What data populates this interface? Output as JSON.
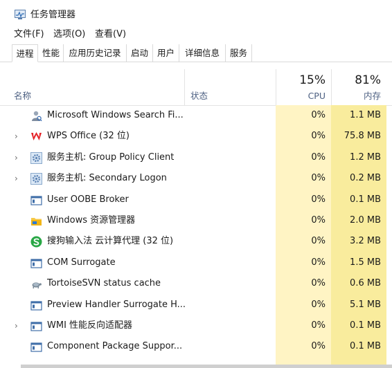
{
  "window": {
    "title": "任务管理器",
    "app_icon": "task-manager-icon"
  },
  "menu": [
    "文件(F)",
    "选项(O)",
    "查看(V)"
  ],
  "tabs": [
    "进程",
    "性能",
    "应用历史记录",
    "启动",
    "用户",
    "详细信息",
    "服务"
  ],
  "active_tab": "进程",
  "columns": {
    "name": "名称",
    "status": "状态",
    "cpu": {
      "label": "CPU",
      "percent": "15%"
    },
    "memory": {
      "label": "内存",
      "percent": "81%"
    }
  },
  "highlight_colors": {
    "cpu": "#fff4c4",
    "memory": "#f9ec9d"
  },
  "processes": [
    {
      "name": "Microsoft Windows Search Fi...",
      "cpu": "0%",
      "memory": "1.1 MB",
      "expandable": false,
      "icon": "search-filter-icon"
    },
    {
      "name": "WPS Office (32 位)",
      "cpu": "0%",
      "memory": "75.8 MB",
      "expandable": true,
      "icon": "wps-logo-icon"
    },
    {
      "name": "服务主机: Group Policy Client",
      "cpu": "0%",
      "memory": "1.2 MB",
      "expandable": true,
      "icon": "service-gear-icon"
    },
    {
      "name": "服务主机: Secondary Logon",
      "cpu": "0%",
      "memory": "0.2 MB",
      "expandable": true,
      "icon": "service-gear-icon"
    },
    {
      "name": "User OOBE Broker",
      "cpu": "0%",
      "memory": "0.1 MB",
      "expandable": false,
      "icon": "app-window-icon"
    },
    {
      "name": "Windows 资源管理器",
      "cpu": "0%",
      "memory": "2.0 MB",
      "expandable": false,
      "icon": "folder-icon"
    },
    {
      "name": "搜狗输入法 云计算代理 (32 位)",
      "cpu": "0%",
      "memory": "3.2 MB",
      "expandable": false,
      "icon": "sogou-icon"
    },
    {
      "name": "COM Surrogate",
      "cpu": "0%",
      "memory": "1.5 MB",
      "expandable": false,
      "icon": "app-window-icon"
    },
    {
      "name": "TortoiseSVN status cache",
      "cpu": "0%",
      "memory": "0.6 MB",
      "expandable": false,
      "icon": "tortoise-icon"
    },
    {
      "name": "Preview Handler Surrogate H...",
      "cpu": "0%",
      "memory": "5.1 MB",
      "expandable": false,
      "icon": "app-window-icon"
    },
    {
      "name": "WMI 性能反向适配器",
      "cpu": "0%",
      "memory": "0.1 MB",
      "expandable": true,
      "icon": "app-window-icon"
    },
    {
      "name": "Component Package Suppor...",
      "cpu": "0%",
      "memory": "0.1 MB",
      "expandable": false,
      "icon": "app-window-icon"
    }
  ]
}
